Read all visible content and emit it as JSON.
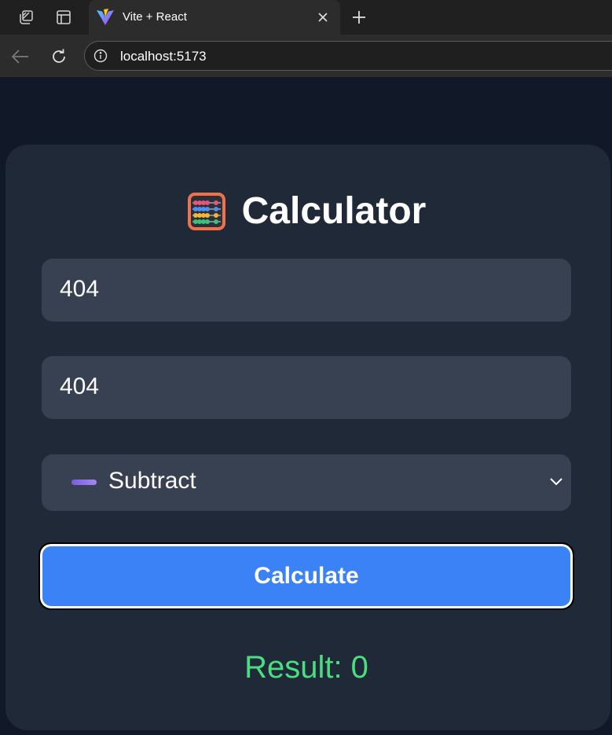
{
  "browser": {
    "tab_title": "Vite + React",
    "url": "localhost:5173"
  },
  "app": {
    "title": "Calculator",
    "title_icon": "abacus-icon",
    "first_number": "404",
    "second_number": "404",
    "operation": {
      "selected": "Subtract",
      "icon": "minus-icon"
    },
    "calculate_label": "Calculate",
    "result_text": "Result: 0"
  },
  "colors": {
    "page_bg": "#111827",
    "card_bg": "#1f2937",
    "field_bg": "#374151",
    "button_bg": "#3b82f6",
    "result_text": "#4ade80"
  }
}
